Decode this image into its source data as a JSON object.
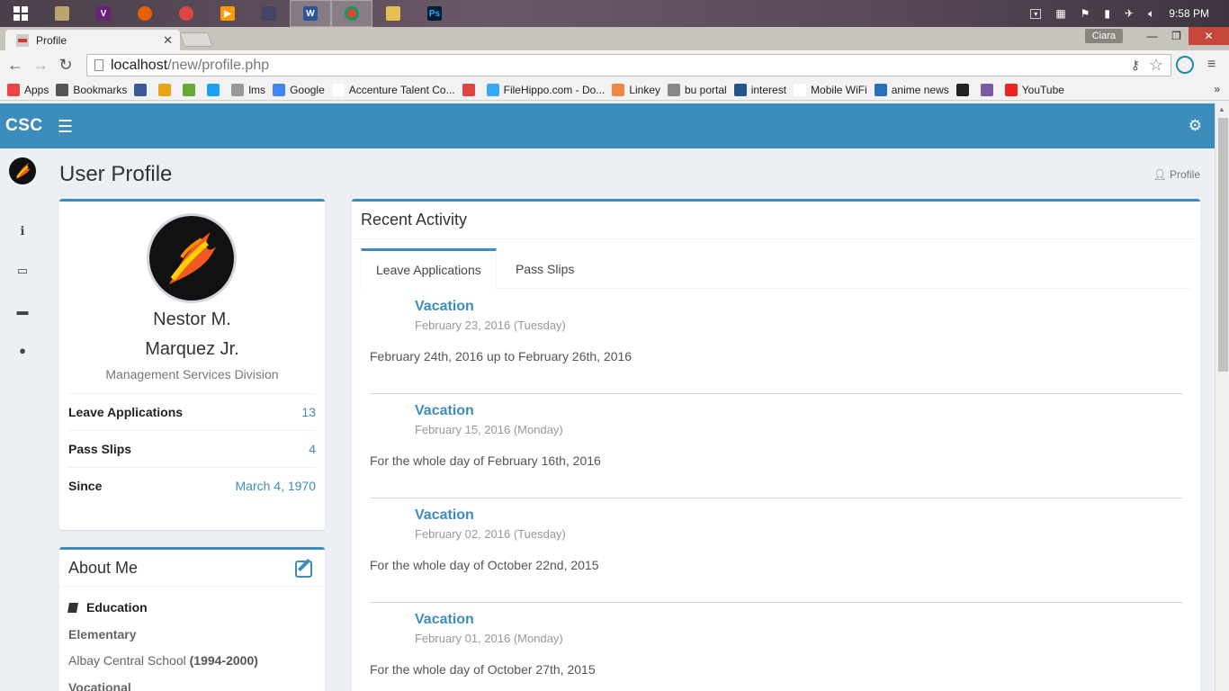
{
  "taskbar": {
    "clock": "9:58 PM"
  },
  "browser": {
    "tab_title": "Profile",
    "window_user": "Ciara",
    "url_host": "localhost",
    "url_path": "/new/profile.php"
  },
  "bookmarks": [
    {
      "label": "Apps",
      "color": "#e44"
    },
    {
      "label": "Bookmarks",
      "color": "#555"
    },
    {
      "label": "",
      "color": "#3b5998"
    },
    {
      "label": "",
      "color": "#e8a317"
    },
    {
      "label": "",
      "color": "#6a3"
    },
    {
      "label": "",
      "color": "#1da1f2"
    },
    {
      "label": "lms",
      "color": "#999"
    },
    {
      "label": "Google",
      "color": "#4285f4"
    },
    {
      "label": "Accenture Talent Co...",
      "color": "#fff"
    },
    {
      "label": "",
      "color": "#d44"
    },
    {
      "label": "FileHippo.com - Do...",
      "color": "#3af"
    },
    {
      "label": "Linkey",
      "color": "#e84"
    },
    {
      "label": "bu portal",
      "color": "#888"
    },
    {
      "label": "interest",
      "color": "#258"
    },
    {
      "label": "Mobile WiFi",
      "color": "#fff"
    },
    {
      "label": "anime news",
      "color": "#2a6ebb"
    },
    {
      "label": "",
      "color": "#222"
    },
    {
      "label": "",
      "color": "#7a5aa0"
    },
    {
      "label": "YouTube",
      "color": "#e22"
    }
  ],
  "app": {
    "logo": "CSC",
    "accent_color": "#3c8dbc"
  },
  "page": {
    "title": "User Profile",
    "breadcrumb": "Profile"
  },
  "profile": {
    "name_line1": "Nestor M.",
    "name_line2": "Marquez Jr.",
    "division": "Management Services Division",
    "stats": [
      {
        "label": "Leave Applications",
        "value": "13"
      },
      {
        "label": "Pass Slips",
        "value": "4"
      },
      {
        "label": "Since",
        "value": "March 4, 1970"
      }
    ]
  },
  "about": {
    "title": "About Me",
    "education_heading": "Education",
    "elementary_label": "Elementary",
    "elementary_school": "Albay Central School",
    "elementary_years": "(1994-2000)",
    "vocational_label": "Vocational"
  },
  "activity": {
    "title": "Recent Activity",
    "tabs": [
      "Leave Applications",
      "Pass Slips"
    ],
    "posts": [
      {
        "title": "Vacation",
        "date": "February 23, 2016 (Tuesday)",
        "desc": "February 24th, 2016 up to February 26th, 2016"
      },
      {
        "title": "Vacation",
        "date": "February 15, 2016 (Monday)",
        "desc": "For the whole day of February 16th, 2016"
      },
      {
        "title": "Vacation",
        "date": "February 02, 2016 (Tuesday)",
        "desc": "For the whole day of October 22nd, 2015"
      },
      {
        "title": "Vacation",
        "date": "February 01, 2016 (Monday)",
        "desc": "For the whole day of October 27th, 2015"
      }
    ]
  }
}
